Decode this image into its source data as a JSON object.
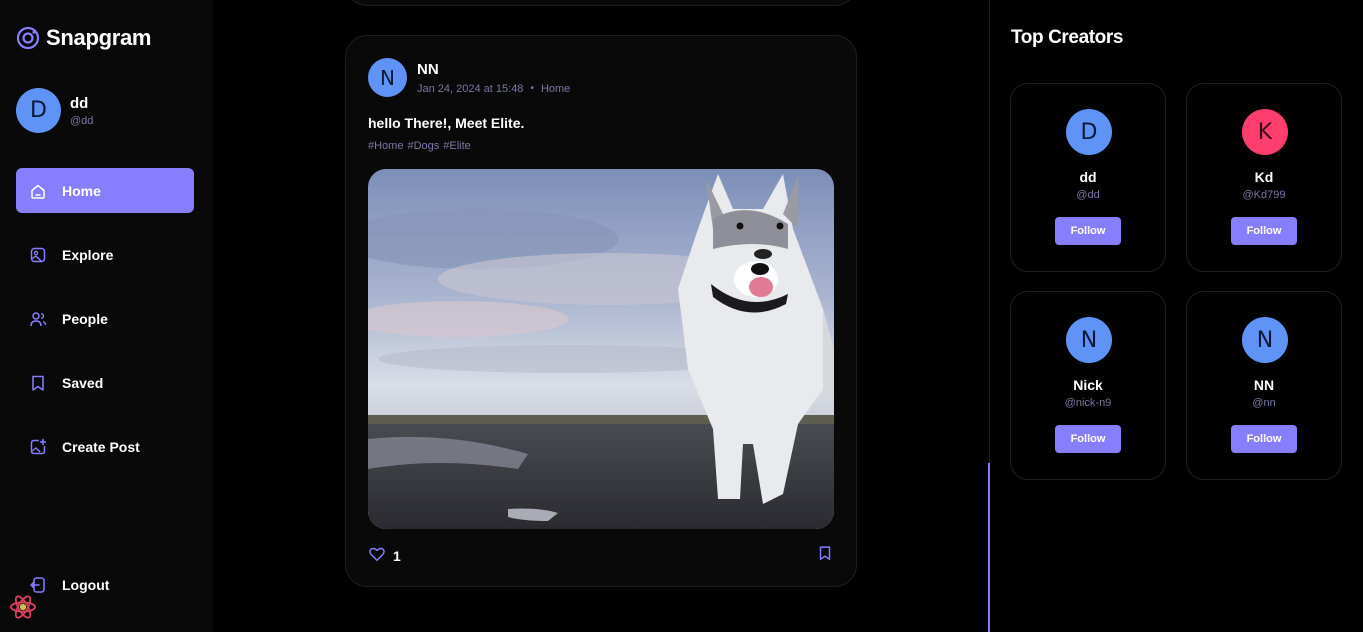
{
  "brand": {
    "name": "Snapgram"
  },
  "user": {
    "name": "dd",
    "handle": "@dd",
    "initial": "D"
  },
  "nav": [
    {
      "label": "Home",
      "icon": "home-icon",
      "active": true
    },
    {
      "label": "Explore",
      "icon": "wallpaper-icon",
      "active": false
    },
    {
      "label": "People",
      "icon": "people-icon",
      "active": false
    },
    {
      "label": "Saved",
      "icon": "bookmark-icon",
      "active": false
    },
    {
      "label": "Create Post",
      "icon": "gallery-add-icon",
      "active": false
    }
  ],
  "logout": {
    "label": "Logout"
  },
  "post": {
    "author": "NN",
    "initial": "N",
    "date": "Jan 24, 2024 at 15:48",
    "location": "Home",
    "caption": "hello There!, Meet Elite.",
    "tags": [
      "#Home",
      "#Dogs",
      "#Elite"
    ],
    "likes": "1"
  },
  "right_panel": {
    "title": "Top Creators",
    "creators": [
      {
        "name": "dd",
        "handle": "@dd",
        "initial": "D",
        "follow_label": "Follow"
      },
      {
        "name": "Kd",
        "handle": "@Kd799",
        "initial": "K",
        "follow_label": "Follow"
      },
      {
        "name": "Nick",
        "handle": "@nick-n9",
        "initial": "N",
        "follow_label": "Follow"
      },
      {
        "name": "NN",
        "handle": "@nn",
        "initial": "N",
        "follow_label": "Follow"
      }
    ]
  },
  "colors": {
    "accent": "#877eff",
    "avatar_blue": "#5f93f5",
    "avatar_pink": "#ff3d6e",
    "muted": "#7878a3",
    "card": "#09090a"
  }
}
